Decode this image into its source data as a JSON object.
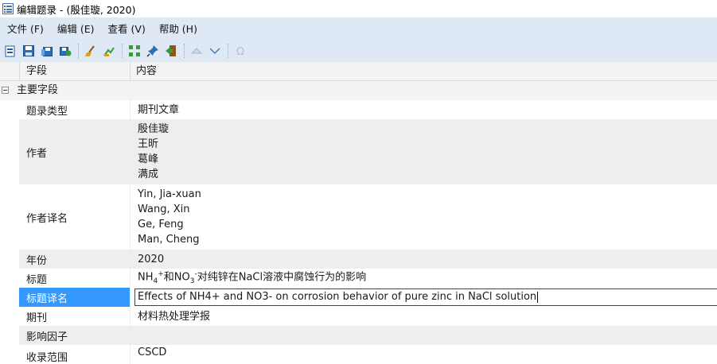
{
  "window": {
    "title": "编辑题录 - (殷佳璇, 2020)"
  },
  "menu": [
    {
      "label": "文件 (F)"
    },
    {
      "label": "编辑 (E)"
    },
    {
      "label": "查看 (V)"
    },
    {
      "label": "帮助 (H)"
    }
  ],
  "columns": {
    "field": "字段",
    "content": "内容"
  },
  "group": {
    "label": "主要字段"
  },
  "rows": {
    "ref_type": {
      "field": "题录类型",
      "value": "期刊文章"
    },
    "authors": {
      "field": "作者",
      "values": [
        "殷佳璇",
        "王昕",
        "葛峰",
        "满成"
      ]
    },
    "authors_trans": {
      "field": "作者译名",
      "values": [
        "Yin, Jia-xuan",
        "Wang, Xin",
        "Ge, Feng",
        "Man, Cheng"
      ]
    },
    "year": {
      "field": "年份",
      "value": "2020"
    },
    "title": {
      "field": "标题",
      "p1": "NH",
      "sub1": "4",
      "sup1": "+",
      "p2": "和NO",
      "sub2": "3",
      "sup2": "-",
      "p3": "对纯锌在NaCl溶液中腐蚀行为的影响"
    },
    "title_trans": {
      "field": "标题译名",
      "value": "Effects of NH4+ and NO3- on corrosion behavior of pure zinc in NaCl solution"
    },
    "journal": {
      "field": "期刊",
      "value": "材料热处理学报"
    },
    "impact": {
      "field": "影响因子",
      "value": ""
    },
    "indexed": {
      "field": "收录范围",
      "value": "CSCD"
    }
  },
  "colors": {
    "menubar_bg": "#dfe9f5",
    "selection": "#3399ff",
    "alt_row": "#eeeeee"
  }
}
